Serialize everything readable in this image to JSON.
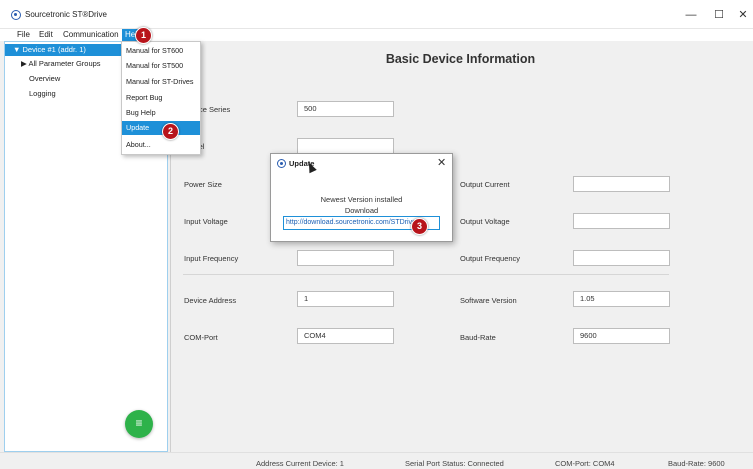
{
  "window": {
    "title": "Sourcetronic ST®Drive",
    "minimize_glyph": "—",
    "maximize_glyph": "☐",
    "close_glyph": "✕"
  },
  "menubar": {
    "file": "File",
    "edit": "Edit",
    "communication": "Communication",
    "help": "Help"
  },
  "help_menu": {
    "items": [
      "Manual for ST600",
      "Manual for ST500",
      "Manual for ST-Drives",
      "Report Bug",
      "Bug Help",
      "Update",
      "About..."
    ]
  },
  "sidebar": {
    "device": "▼ Device #1 (addr. 1)",
    "groups": "▶ All Parameter Groups",
    "overview": "Overview",
    "logging": "Logging",
    "fab_glyph": "≡"
  },
  "main": {
    "title": "Basic Device Information",
    "series_label": "Device Series",
    "series_value": "500",
    "model_label": "Model",
    "model_value": "",
    "power_label": "Power Size",
    "power_value": "",
    "output_current_label": "Output Current",
    "output_current_value": "",
    "input_voltage_label": "Input Voltage",
    "input_voltage_value": "",
    "output_voltage_label": "Output Voltage",
    "output_voltage_value": "",
    "input_frequency_label": "Input Frequency",
    "input_frequency_value": "",
    "output_frequency_label": "Output Frequency",
    "output_frequency_value": "",
    "device_address_label": "Device Address",
    "device_address_value": "1",
    "software_version_label": "Software Version",
    "software_version_value": "1.05",
    "com_port_label": "COM-Port",
    "com_port_value": "COM4",
    "baud_rate_label": "Baud-Rate",
    "baud_rate_value": "9600"
  },
  "dialog": {
    "title": "Update",
    "close_glyph": "✕",
    "message": "Newest Version installed",
    "download_label": "Download",
    "link": "http://download.sourcetronic.com/STDrive"
  },
  "badges": [
    "1",
    "2",
    "3"
  ],
  "status": {
    "address": "Address Current Device: 1",
    "serial": "Serial Port Status: Connected",
    "com_port": "COM-Port:  COM4",
    "baud_rate": "Baud-Rate: 9600"
  },
  "colors": {
    "accent": "#1e90d8",
    "badge": "#b8141b",
    "fab": "#2eb24a"
  }
}
